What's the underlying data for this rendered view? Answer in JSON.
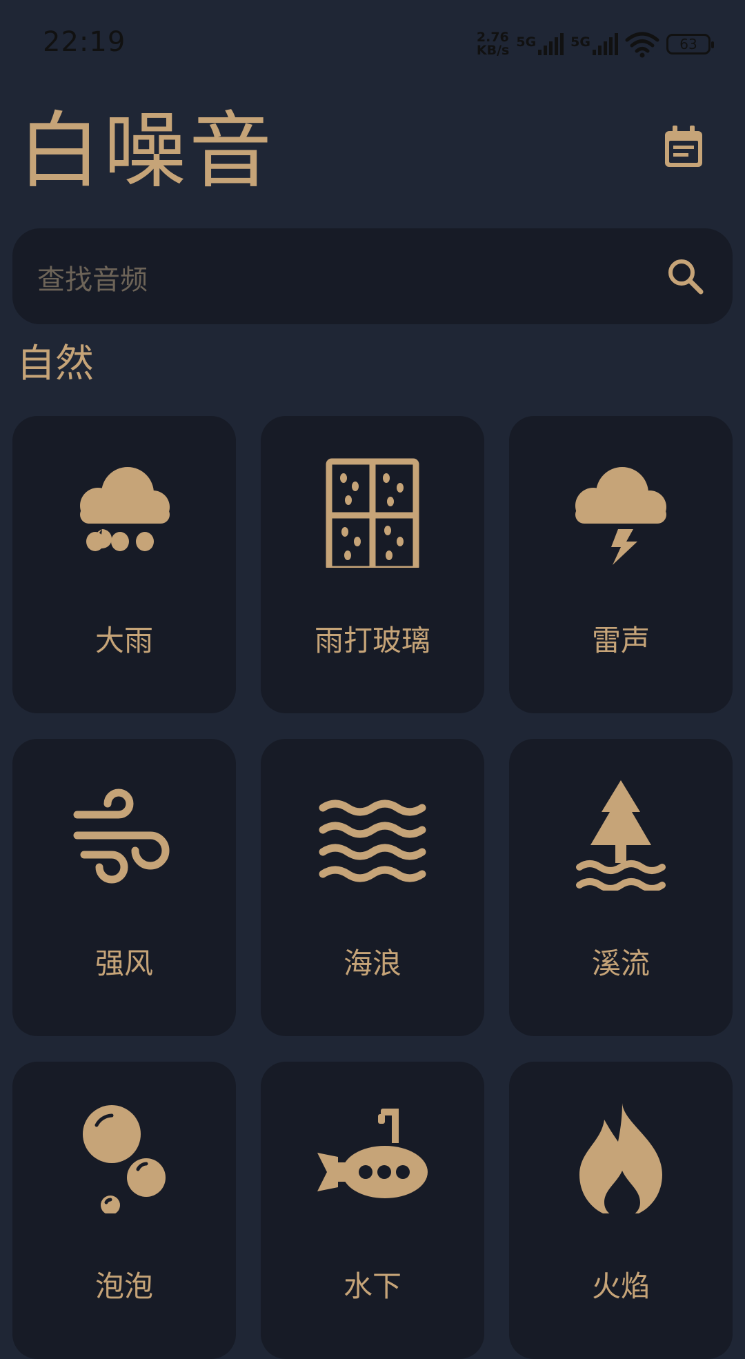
{
  "status_bar": {
    "time": "22:19",
    "speed_value": "2.76",
    "speed_unit": "KB/s",
    "net1": "5G",
    "net2": "5G",
    "battery": "63"
  },
  "header": {
    "title": "白噪音",
    "calendar_icon": "calendar-icon"
  },
  "search": {
    "placeholder": "查找音频",
    "icon": "search-icon"
  },
  "section": {
    "title": "自然"
  },
  "sounds": [
    {
      "label": "大雨",
      "icon": "rain-cloud-icon"
    },
    {
      "label": "雨打玻璃",
      "icon": "rainy-window-icon"
    },
    {
      "label": "雷声",
      "icon": "thunder-cloud-icon"
    },
    {
      "label": "强风",
      "icon": "wind-icon"
    },
    {
      "label": "海浪",
      "icon": "waves-icon"
    },
    {
      "label": "溪流",
      "icon": "tree-stream-icon"
    },
    {
      "label": "泡泡",
      "icon": "bubbles-icon"
    },
    {
      "label": "水下",
      "icon": "submarine-icon"
    },
    {
      "label": "火焰",
      "icon": "flame-icon"
    }
  ],
  "colors": {
    "background": "#1f2635",
    "card": "#171b26",
    "accent": "#c6a478",
    "placeholder": "#6d6458"
  }
}
